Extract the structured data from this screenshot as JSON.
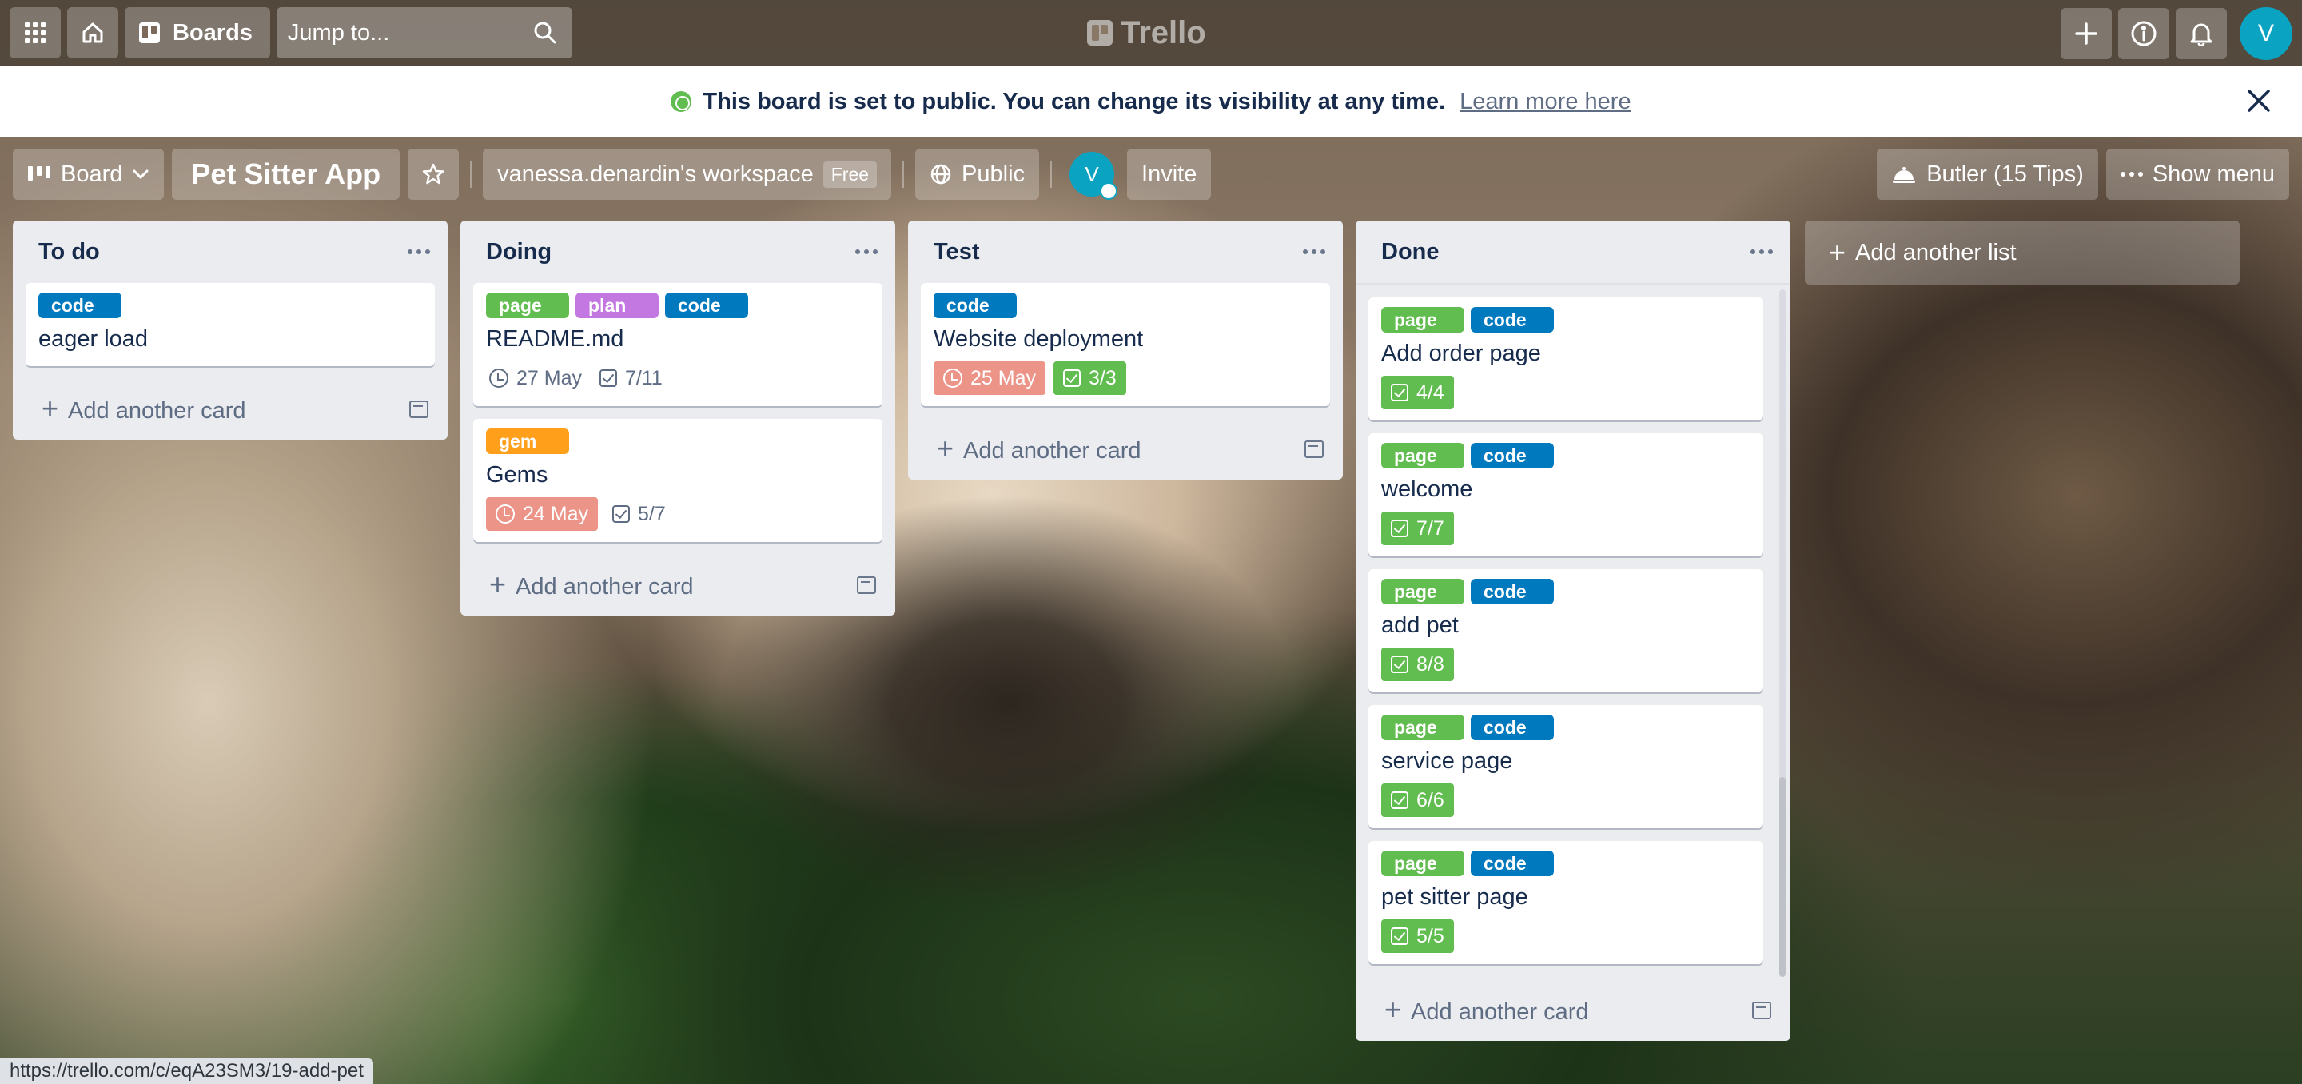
{
  "app": {
    "logo_text": "Trello"
  },
  "header": {
    "boards_label": "Boards",
    "search_placeholder": "Jump to...",
    "user_initial": "V"
  },
  "banner": {
    "message": "This board is set to public. You can change its visibility at any time.",
    "link": "Learn more here"
  },
  "board": {
    "view_label": "Board",
    "title": "Pet Sitter App",
    "workspace": "vanessa.denardin's workspace",
    "workspace_plan": "Free",
    "visibility": "Public",
    "member_initial": "V",
    "invite_label": "Invite",
    "butler_label": "Butler (15 Tips)",
    "menu_label": "Show menu"
  },
  "lists": [
    {
      "title": "To do",
      "cards": [
        {
          "labels": [
            {
              "text": "code",
              "color": "#0079bf"
            }
          ],
          "title": "eager load"
        }
      ]
    },
    {
      "title": "Doing",
      "cards": [
        {
          "labels": [
            {
              "text": "page",
              "color": "#61bd4f"
            },
            {
              "text": "plan",
              "color": "#c377e0"
            },
            {
              "text": "code",
              "color": "#0079bf"
            }
          ],
          "title": "README.md",
          "due": "27 May",
          "checklist": "7/11"
        },
        {
          "labels": [
            {
              "text": "gem",
              "color": "#ff9f1a"
            }
          ],
          "title": "Gems",
          "due": "24 May",
          "checklist": "5/7"
        }
      ]
    },
    {
      "title": "Test",
      "cards": [
        {
          "labels": [
            {
              "text": "code",
              "color": "#0079bf"
            }
          ],
          "title": "Website deployment",
          "due": "25 May",
          "checklist": "3/3"
        }
      ]
    },
    {
      "title": "Done",
      "cards": [
        {
          "labels": [
            {
              "text": "page",
              "color": "#61bd4f"
            },
            {
              "text": "code",
              "color": "#0079bf"
            }
          ],
          "title": "Add order page",
          "checklist": "4/4"
        },
        {
          "labels": [
            {
              "text": "page",
              "color": "#61bd4f"
            },
            {
              "text": "code",
              "color": "#0079bf"
            }
          ],
          "title": "welcome",
          "checklist": "7/7"
        },
        {
          "labels": [
            {
              "text": "page",
              "color": "#61bd4f"
            },
            {
              "text": "code",
              "color": "#0079bf"
            }
          ],
          "title": "add pet",
          "checklist": "8/8"
        },
        {
          "labels": [
            {
              "text": "page",
              "color": "#61bd4f"
            },
            {
              "text": "code",
              "color": "#0079bf"
            }
          ],
          "title": "service page",
          "checklist": "6/6"
        },
        {
          "labels": [
            {
              "text": "page",
              "color": "#61bd4f"
            },
            {
              "text": "code",
              "color": "#0079bf"
            }
          ],
          "title": "pet sitter page",
          "checklist": "5/5"
        }
      ]
    }
  ],
  "add_card_label": "Add another card",
  "add_list_label": "Add another list",
  "status_url": "https://trello.com/c/eqA23SM3/19-add-pet"
}
